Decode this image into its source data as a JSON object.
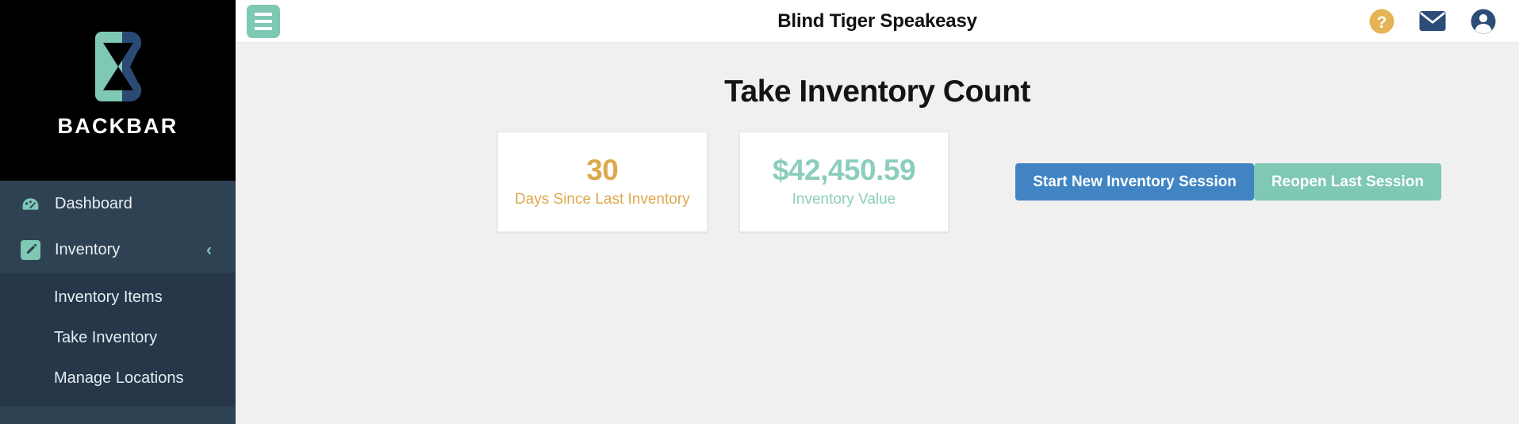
{
  "sidebar": {
    "brand": {
      "word": "BACKBAR",
      "logo_icon": "backbar-hourglass-logo",
      "teal": "#7ec8b4",
      "navy": "#2a4a74"
    },
    "items": [
      {
        "label": "Dashboard",
        "icon": "tachometer-icon",
        "expandable": false
      },
      {
        "label": "Inventory",
        "icon": "pencil-square-icon",
        "expandable": true,
        "chevron": "‹"
      }
    ],
    "submenu": [
      {
        "label": "Inventory Items"
      },
      {
        "label": "Take Inventory"
      },
      {
        "label": "Manage Locations"
      }
    ]
  },
  "topbar": {
    "menu_icon": "hamburger-icon",
    "title": "Blind Tiger Speakeasy",
    "icons": [
      {
        "name": "help-icon",
        "glyph": "?",
        "color": "#e6b355"
      },
      {
        "name": "mail-icon",
        "glyph": "✉",
        "color": "#2d4d79"
      },
      {
        "name": "user-account-icon",
        "glyph": "●",
        "color": "#2d4d79"
      }
    ]
  },
  "main": {
    "page_title": "Take Inventory Count",
    "cards": [
      {
        "value": "30",
        "label": "Days Since Last Inventory",
        "color": "#dda94e"
      },
      {
        "value": "$42,450.59",
        "label": "Inventory Value",
        "color": "#8ccdbd"
      }
    ],
    "buttons": {
      "start_new": "Start New Inventory Session",
      "reopen_last": "Reopen Last Session"
    }
  }
}
